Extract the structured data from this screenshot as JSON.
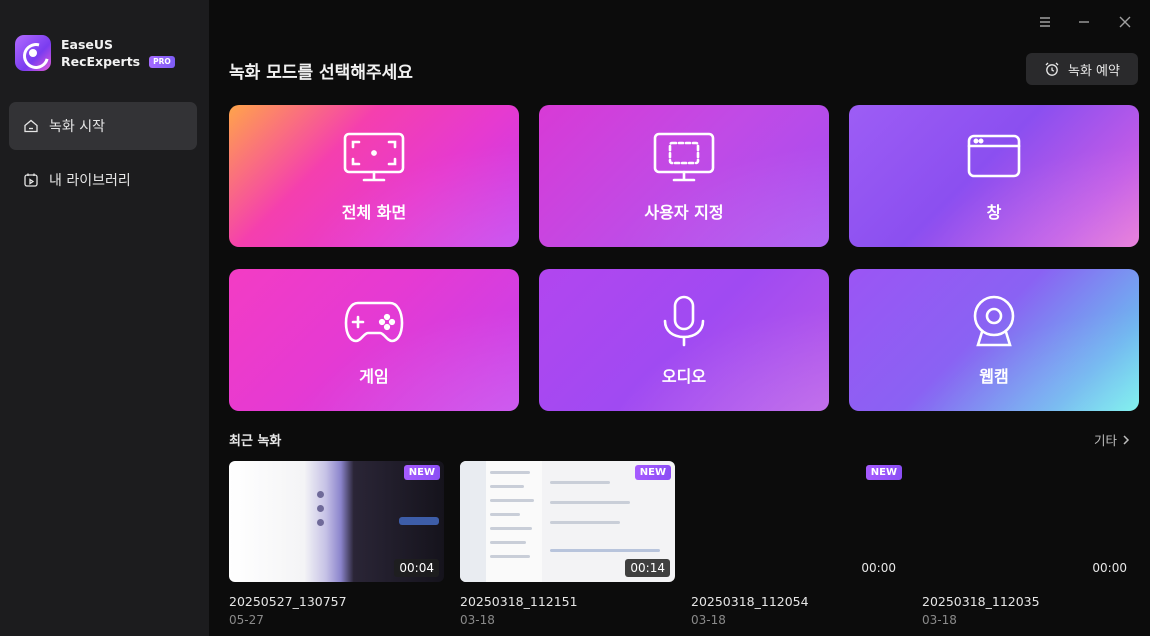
{
  "brand": {
    "name": "EaseUS",
    "product": "RecExperts",
    "badge": "PRO"
  },
  "sidebar": {
    "items": [
      {
        "label": "녹화 시작",
        "icon": "home-icon",
        "active": true
      },
      {
        "label": "내 라이브러리",
        "icon": "library-icon",
        "active": false
      }
    ]
  },
  "window": {
    "menu_icon": "menu-icon",
    "minimize_icon": "minimize-icon",
    "close_icon": "close-icon"
  },
  "main": {
    "title": "녹화 모드를 선택해주세요",
    "schedule_label": "녹화 예약",
    "modes": [
      {
        "label": "전체 화면",
        "icon": "fullscreen-monitor-icon"
      },
      {
        "label": "사용자 지정",
        "icon": "custom-region-monitor-icon"
      },
      {
        "label": "창",
        "icon": "window-icon"
      },
      {
        "label": "게임",
        "icon": "gamepad-icon"
      },
      {
        "label": "오디오",
        "icon": "microphone-icon"
      },
      {
        "label": "웹캠",
        "icon": "webcam-icon"
      }
    ],
    "recent_title": "최근 녹화",
    "more_label": "기타",
    "recordings": [
      {
        "name": "20250527_130757",
        "date": "05-27",
        "duration": "00:04",
        "badge": "NEW"
      },
      {
        "name": "20250318_112151",
        "date": "03-18",
        "duration": "00:14",
        "badge": "NEW"
      },
      {
        "name": "20250318_112054",
        "date": "03-18",
        "duration": "00:00",
        "badge": "NEW"
      },
      {
        "name": "20250318_112035",
        "date": "03-18",
        "duration": "00:00",
        "badge": ""
      }
    ]
  },
  "colors": {
    "accent": "#a65bff",
    "sidebar_bg": "#1c1c1e",
    "main_bg": "#0c0c0c"
  }
}
